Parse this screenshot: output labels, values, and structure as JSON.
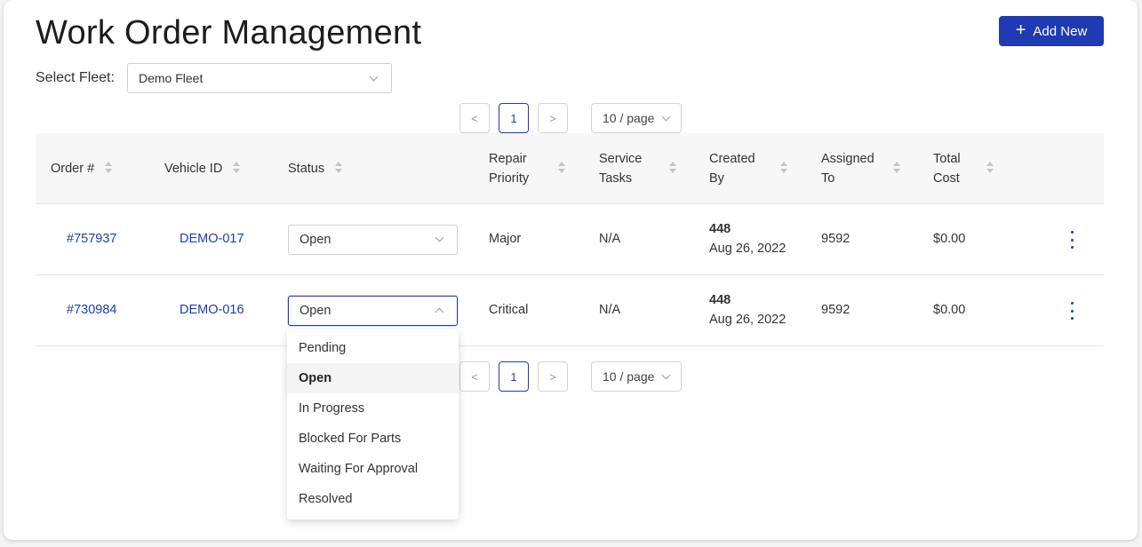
{
  "page": {
    "title": "Work Order Management",
    "add_button_label": "Add New",
    "fleet_label": "Select Fleet:",
    "fleet_value": "Demo Fleet"
  },
  "pagination": {
    "prev": "<",
    "current_page": "1",
    "next": ">",
    "page_size": "10 / page"
  },
  "table": {
    "columns": [
      {
        "l1": "Order #",
        "l2": ""
      },
      {
        "l1": "Vehicle ID",
        "l2": ""
      },
      {
        "l1": "Status",
        "l2": ""
      },
      {
        "l1": "Repair",
        "l2": "Priority"
      },
      {
        "l1": "Service",
        "l2": "Tasks"
      },
      {
        "l1": "Created",
        "l2": "By"
      },
      {
        "l1": "Assigned",
        "l2": "To"
      },
      {
        "l1": "Total",
        "l2": "Cost"
      }
    ],
    "rows": [
      {
        "order": "#757937",
        "vehicle": "DEMO-017",
        "status": "Open",
        "priority": "Major",
        "tasks": "N/A",
        "created_by": "448",
        "created_date": "Aug 26, 2022",
        "assigned_to": "9592",
        "total_cost": "$0.00"
      },
      {
        "order": "#730984",
        "vehicle": "DEMO-016",
        "status": "Open",
        "priority": "Critical",
        "tasks": "N/A",
        "created_by": "448",
        "created_date": "Aug 26, 2022",
        "assigned_to": "9592",
        "total_cost": "$0.00"
      }
    ]
  },
  "status_dropdown": {
    "options": [
      "Pending",
      "Open",
      "In Progress",
      "Blocked For Parts",
      "Waiting For Approval",
      "Resolved"
    ],
    "selected": "Open"
  },
  "colors": {
    "accent": "#1f3bb3",
    "header_bg": "#f7f7f7"
  }
}
